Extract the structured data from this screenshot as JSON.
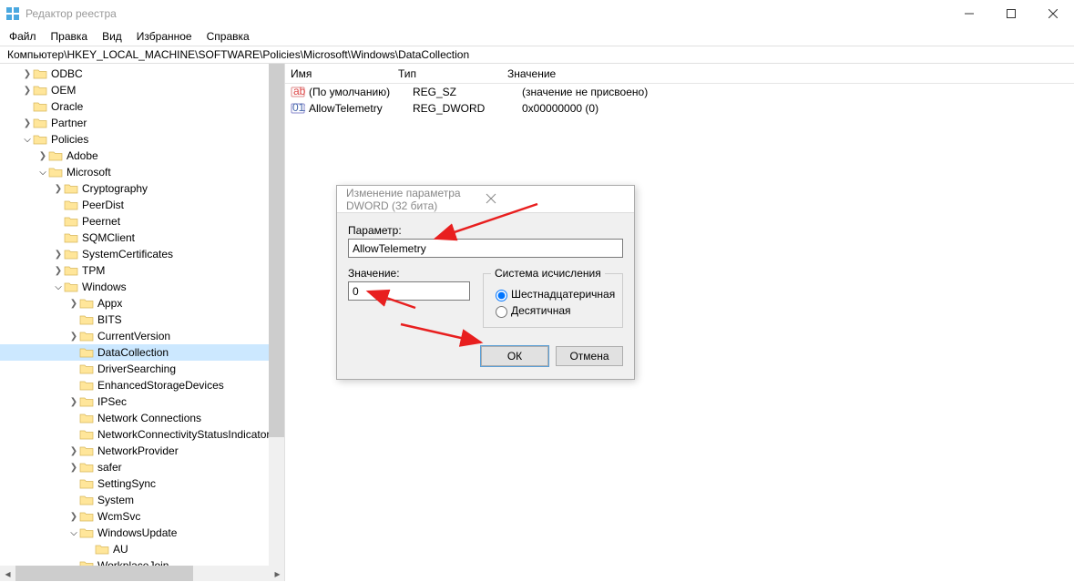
{
  "title": "Редактор реестра",
  "menu": [
    "Файл",
    "Правка",
    "Вид",
    "Избранное",
    "Справка"
  ],
  "path": "Компьютер\\HKEY_LOCAL_MACHINE\\SOFTWARE\\Policies\\Microsoft\\Windows\\DataCollection",
  "cols": {
    "name": "Имя",
    "type": "Тип",
    "value": "Значение"
  },
  "values": [
    {
      "name": "(По умолчанию)",
      "type": "REG_SZ",
      "value": "(значение не присвоено)",
      "icon": "str"
    },
    {
      "name": "AllowTelemetry",
      "type": "REG_DWORD",
      "value": "0x00000000 (0)",
      "icon": "bin"
    }
  ],
  "tree": [
    {
      "d": 0,
      "l": "ODBC",
      "c": 1
    },
    {
      "d": 0,
      "l": "OEM",
      "c": 1
    },
    {
      "d": 0,
      "l": "Oracle",
      "c": 0
    },
    {
      "d": 0,
      "l": "Partner",
      "c": 1
    },
    {
      "d": 0,
      "l": "Policies",
      "c": 2
    },
    {
      "d": 1,
      "l": "Adobe",
      "c": 1
    },
    {
      "d": 1,
      "l": "Microsoft",
      "c": 2
    },
    {
      "d": 2,
      "l": "Cryptography",
      "c": 1
    },
    {
      "d": 2,
      "l": "PeerDist",
      "c": 0
    },
    {
      "d": 2,
      "l": "Peernet",
      "c": 0
    },
    {
      "d": 2,
      "l": "SQMClient",
      "c": 0
    },
    {
      "d": 2,
      "l": "SystemCertificates",
      "c": 1
    },
    {
      "d": 2,
      "l": "TPM",
      "c": 1
    },
    {
      "d": 2,
      "l": "Windows",
      "c": 2
    },
    {
      "d": 3,
      "l": "Appx",
      "c": 1
    },
    {
      "d": 3,
      "l": "BITS",
      "c": 0
    },
    {
      "d": 3,
      "l": "CurrentVersion",
      "c": 1
    },
    {
      "d": 3,
      "l": "DataCollection",
      "c": 0,
      "sel": true
    },
    {
      "d": 3,
      "l": "DriverSearching",
      "c": 0
    },
    {
      "d": 3,
      "l": "EnhancedStorageDevices",
      "c": 0
    },
    {
      "d": 3,
      "l": "IPSec",
      "c": 1
    },
    {
      "d": 3,
      "l": "Network Connections",
      "c": 0
    },
    {
      "d": 3,
      "l": "NetworkConnectivityStatusIndicator",
      "c": 0
    },
    {
      "d": 3,
      "l": "NetworkProvider",
      "c": 1
    },
    {
      "d": 3,
      "l": "safer",
      "c": 1
    },
    {
      "d": 3,
      "l": "SettingSync",
      "c": 0
    },
    {
      "d": 3,
      "l": "System",
      "c": 0
    },
    {
      "d": 3,
      "l": "WcmSvc",
      "c": 1
    },
    {
      "d": 3,
      "l": "WindowsUpdate",
      "c": 2
    },
    {
      "d": 4,
      "l": "AU",
      "c": 0
    },
    {
      "d": 3,
      "l": "WorkplaceJoin",
      "c": 0
    }
  ],
  "dialog": {
    "title": "Изменение параметра DWORD (32 бита)",
    "param_label": "Параметр:",
    "param_value": "AllowTelemetry",
    "value_label": "Значение:",
    "value_value": "0",
    "base_legend": "Система исчисления",
    "hex": "Шестнадцатеричная",
    "dec": "Десятичная",
    "ok": "ОК",
    "cancel": "Отмена"
  }
}
